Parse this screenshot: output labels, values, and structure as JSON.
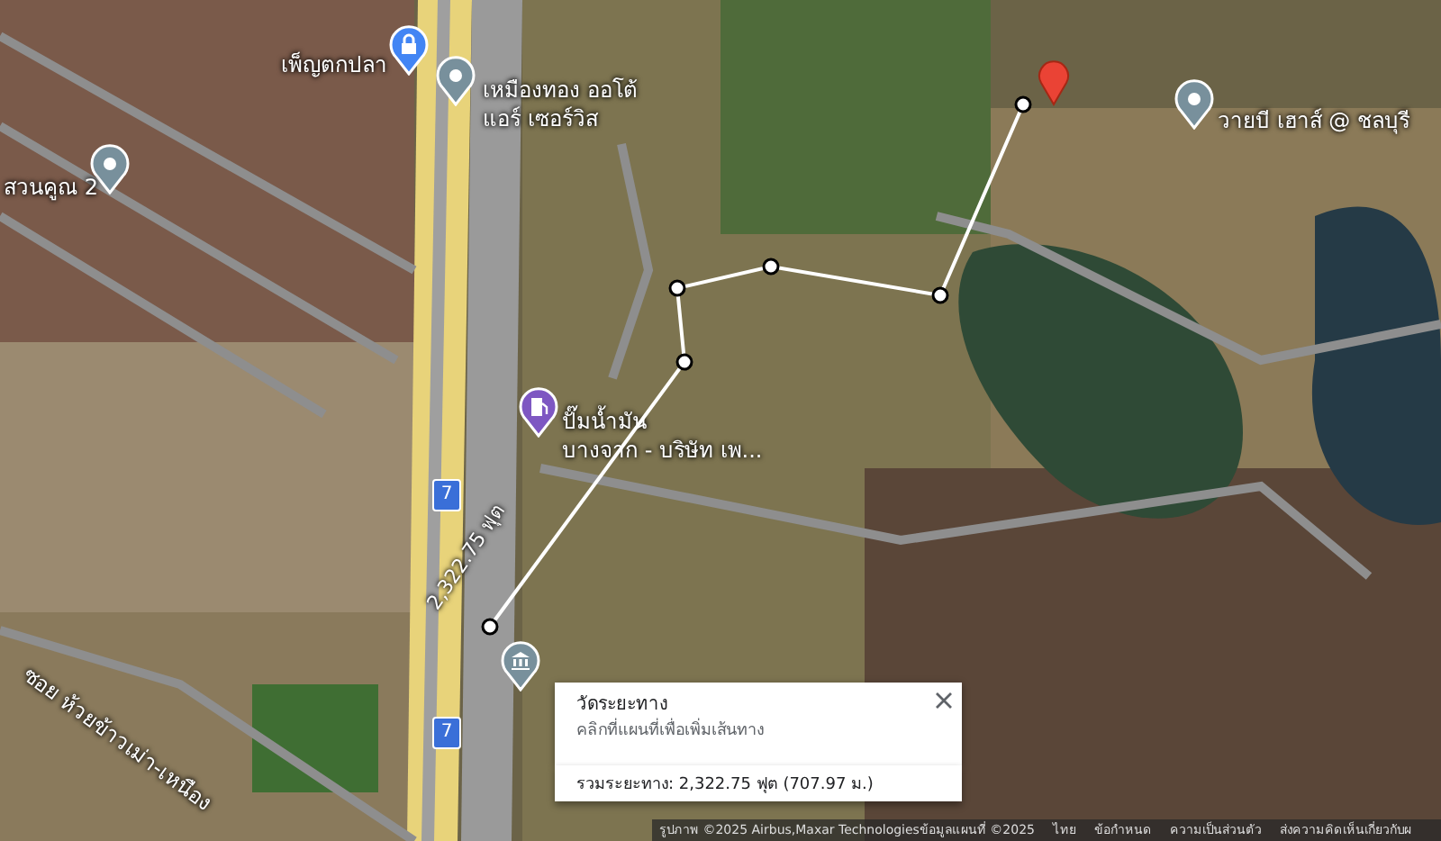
{
  "map": {
    "places": [
      {
        "kind": "lock",
        "lines": [
          "เพ็ญตกปลา"
        ]
      },
      {
        "kind": "pin",
        "lines": [
          "เหมืองทอง ออโต้",
          "แอร์ เซอร์วิส"
        ]
      },
      {
        "kind": "pin",
        "lines": [
          "สวนคูณ 2"
        ]
      },
      {
        "kind": "pin",
        "lines": [
          "วายบี เฮาส์ @ ชลบุรี"
        ]
      },
      {
        "kind": "gas",
        "lines": [
          "ปั๊มน้ำมัน",
          "บางจาก - บริษัท เพ..."
        ]
      },
      {
        "kind": "bank"
      }
    ],
    "road_labels": [
      "ซอย ห้วยข้าวเม่า-เหนือง"
    ],
    "highway_shields": [
      "7",
      "7"
    ],
    "measurement": {
      "distance_label": "2,322.75 ฟุต"
    }
  },
  "popup": {
    "title": "วัดระยะทาง",
    "hint": "คลิกที่แผนที่เพื่อเพิ่มเส้นทาง",
    "total": "รวมระยะทาง: 2,322.75 ฟุต (707.97 ม.)"
  },
  "footer": [
    "รูปภาพ ©2025 Airbus,Maxar Technologiesข้อมูลแผนที่ ©2025",
    "ไทย",
    "ข้อกำหนด",
    "ความเป็นส่วนตัว",
    "ส่งความคิดเห็นเกี่ยวกับผ"
  ]
}
